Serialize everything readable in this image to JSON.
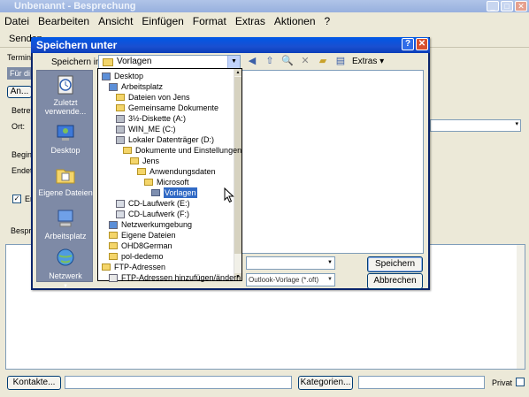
{
  "window": {
    "title": "Unbenannt - Besprechung"
  },
  "menu": [
    "Datei",
    "Bearbeiten",
    "Ansicht",
    "Einfügen",
    "Format",
    "Extras",
    "Aktionen",
    "?"
  ],
  "toolbar": {
    "send_label": "Senden"
  },
  "form": {
    "tab_termin": "Termin",
    "info_label": "Für di",
    "an_button": "An...",
    "betreff": "Betreff",
    "ort": "Ort:",
    "beginn": "Beginn",
    "ende": "Endet",
    "erinnerung": "Er",
    "besprechung": "Bespre"
  },
  "bottom": {
    "kontakte_button": "Kontakte...",
    "kategorien_button": "Kategorien...",
    "privat_label": "Privat"
  },
  "dialog": {
    "title": "Speichern unter",
    "help": "?",
    "close": "✕",
    "lookin_label": "Speichern in:",
    "lookin_value": "Vorlagen",
    "extras_label": "Extras",
    "places": [
      {
        "label": "Zuletzt verwende...",
        "icon": "recent-icon"
      },
      {
        "label": "Desktop",
        "icon": "desktop-icon"
      },
      {
        "label": "Eigene Dateien",
        "icon": "my-documents-icon"
      },
      {
        "label": "Arbeitsplatz",
        "icon": "my-computer-icon"
      },
      {
        "label": "Netzwerk",
        "icon": "network-icon"
      }
    ],
    "dropdown_items": [
      {
        "label": "Desktop",
        "indent": 0,
        "icon": "desktop-icon"
      },
      {
        "label": "Arbeitsplatz",
        "indent": 1,
        "icon": "my-computer-icon"
      },
      {
        "label": "Dateien von Jens",
        "indent": 2,
        "icon": "folder-icon"
      },
      {
        "label": "Gemeinsame Dokumente",
        "indent": 2,
        "icon": "folder-icon"
      },
      {
        "label": "3½-Diskette (A:)",
        "indent": 2,
        "icon": "floppy-icon"
      },
      {
        "label": "WIN_ME (C:)",
        "indent": 2,
        "icon": "drive-icon"
      },
      {
        "label": "Lokaler Datenträger (D:)",
        "indent": 2,
        "icon": "drive-icon"
      },
      {
        "label": "Dokumente und Einstellungen",
        "indent": 3,
        "icon": "folder-icon"
      },
      {
        "label": "Jens",
        "indent": 4,
        "icon": "folder-icon"
      },
      {
        "label": "Anwendungsdaten",
        "indent": 5,
        "icon": "folder-icon"
      },
      {
        "label": "Microsoft",
        "indent": 6,
        "icon": "folder-icon"
      },
      {
        "label": "Vorlagen",
        "indent": 7,
        "icon": "folder-icon",
        "selected": true
      },
      {
        "label": "CD-Laufwerk (E:)",
        "indent": 2,
        "icon": "cd-drive-icon"
      },
      {
        "label": "CD-Laufwerk (F:)",
        "indent": 2,
        "icon": "cd-drive-icon"
      },
      {
        "label": "Netzwerkumgebung",
        "indent": 1,
        "icon": "network-icon"
      },
      {
        "label": "Eigene Dateien",
        "indent": 1,
        "icon": "folder-icon"
      },
      {
        "label": "OHD8German",
        "indent": 1,
        "icon": "folder-icon"
      },
      {
        "label": "pol-dedemo",
        "indent": 1,
        "icon": "folder-icon"
      },
      {
        "label": "FTP-Adressen",
        "indent": 0,
        "icon": "folder-icon"
      },
      {
        "label": "FTP-Adressen hinzufügen/ändern",
        "indent": 1,
        "icon": "ftp-icon"
      }
    ],
    "filetype_value": "Outlook-Vorlage (*.oft)",
    "save_button": "Speichern",
    "cancel_button": "Abbrechen"
  }
}
